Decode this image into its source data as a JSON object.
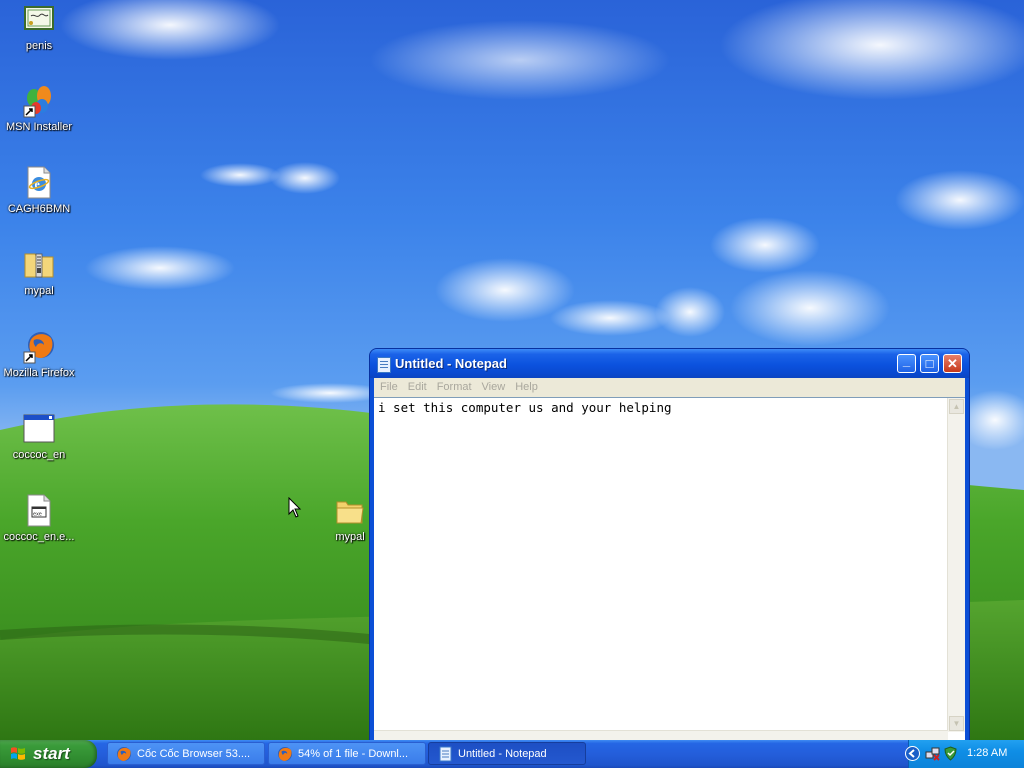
{
  "desktop": {
    "icons": [
      {
        "label": "penis",
        "icon": "certificate-icon"
      },
      {
        "label": "MSN Installer",
        "icon": "msn-butterfly-icon"
      },
      {
        "label": "CAGH6BMN",
        "icon": "ie-document-icon"
      },
      {
        "label": "mypal",
        "icon": "zip-folder-icon"
      },
      {
        "label": "Mozilla Firefox",
        "icon": "firefox-icon"
      },
      {
        "label": "coccoc_en",
        "icon": "application-window-icon"
      },
      {
        "label": "coccoc_en.e...",
        "icon": "exe-file-icon"
      },
      {
        "label": "mypal",
        "icon": "folder-icon"
      }
    ]
  },
  "notepad": {
    "title": "Untitled - Notepad",
    "menu": [
      "File",
      "Edit",
      "Format",
      "View",
      "Help"
    ],
    "content": "i set this computer us and your helping",
    "buttons": {
      "minimize": "_",
      "maximize": "□",
      "close": "✕"
    }
  },
  "taskbar": {
    "start_label": "start",
    "tasks": [
      {
        "label": "Cốc Cốc Browser 53....",
        "icon": "firefox-icon",
        "active": false
      },
      {
        "label": "54% of 1 file - Downl...",
        "icon": "firefox-icon",
        "active": false
      },
      {
        "label": "Untitled - Notepad",
        "icon": "notepad-icon",
        "active": true
      }
    ],
    "clock": "1:28 AM"
  },
  "colors": {
    "taskbar_blue": "#245edb",
    "start_green": "#3a9b3a",
    "titlebar_blue": "#0b52de",
    "tray_blue": "#0f8ee6"
  }
}
